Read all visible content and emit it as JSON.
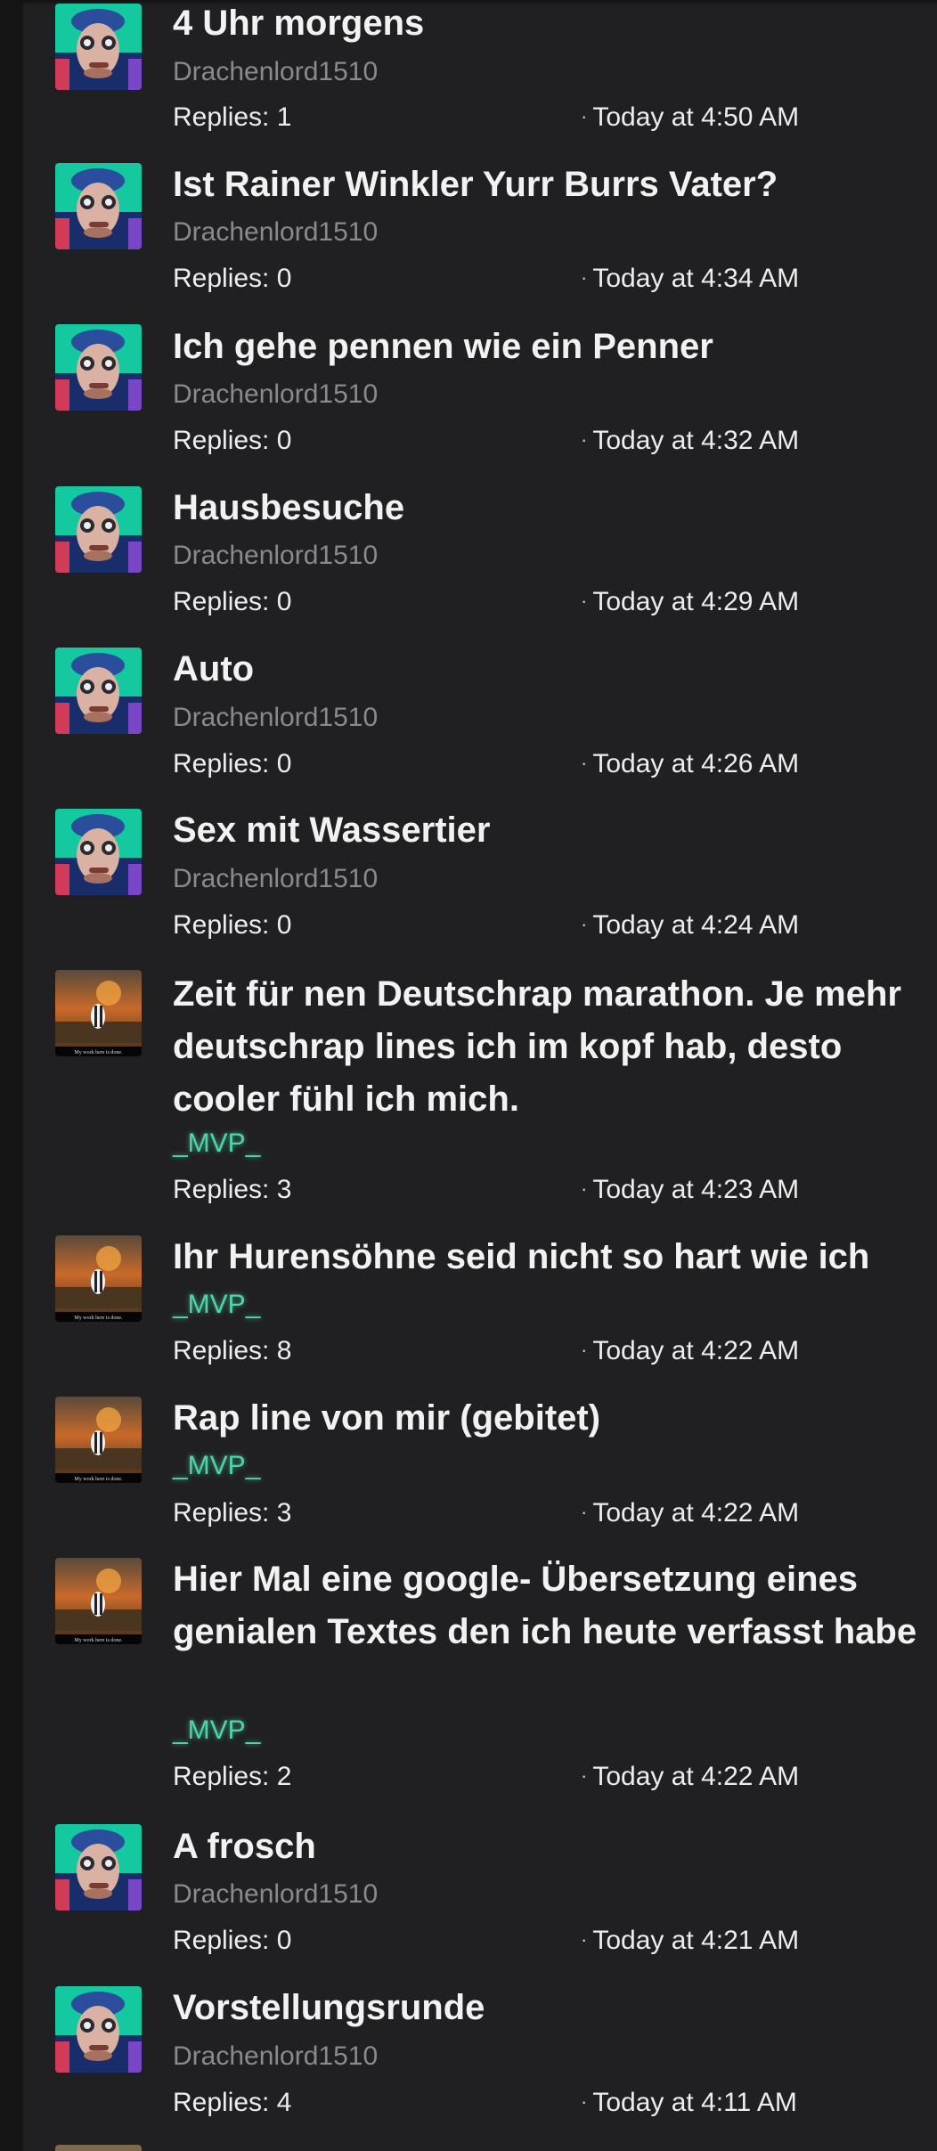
{
  "threads": [
    {
      "title": "4 Uhr morgens",
      "author": "Drachenlord1510",
      "replies": "Replies: 1",
      "date": "Today at 4:50 AM",
      "avatar": "drachenlord-avatar"
    },
    {
      "title": "Ist Rainer Winkler Yurr Burrs Vater?",
      "author": "Drachenlord1510",
      "replies": "Replies: 0",
      "date": "Today at 4:34 AM",
      "avatar": "drachenlord-avatar"
    },
    {
      "title": "Ich gehe pennen wie ein Penner",
      "author": "Drachenlord1510",
      "replies": "Replies: 0",
      "date": "Today at 4:32 AM",
      "avatar": "drachenlord-avatar"
    },
    {
      "title": "Hausbesuche",
      "author": "Drachenlord1510",
      "replies": "Replies: 0",
      "date": "Today at 4:29 AM",
      "avatar": "drachenlord-avatar"
    },
    {
      "title": "Auto",
      "author": "Drachenlord1510",
      "replies": "Replies: 0",
      "date": "Today at 4:26 AM",
      "avatar": "drachenlord-avatar"
    },
    {
      "title": "Sex mit Wassertier",
      "author": "Drachenlord1510",
      "replies": "Replies: 0",
      "date": "Today at 4:24 AM",
      "avatar": "drachenlord-avatar"
    },
    {
      "title": "Zeit für nen Deutschrap marathon. Je mehr deutschrap lines ich im kopf hab, desto cooler fühl ich mich.",
      "author": "_MVP_",
      "replies": "Replies: 3",
      "date": "Today at 4:23 AM",
      "avatar": "mvp-avatar"
    },
    {
      "title": "Ihr Hurensöhne seid nicht so hart wie ich",
      "author": "_MVP_",
      "replies": "Replies: 8",
      "date": "Today at 4:22 AM",
      "avatar": "mvp-avatar"
    },
    {
      "title": "Rap line von mir (gebitet)",
      "author": "_MVP_",
      "replies": "Replies: 3",
      "date": "Today at 4:22 AM",
      "avatar": "mvp-avatar"
    },
    {
      "title": "Hier Mal eine google- Übersetzung eines genialen Textes den ich heute verfasst habe",
      "author": "_MVP_",
      "replies": "Replies: 2",
      "date": "Today at 4:22 AM",
      "avatar": "mvp-avatar"
    },
    {
      "title": "A frosch",
      "author": "Drachenlord1510",
      "replies": "Replies: 0",
      "date": "Today at 4:21 AM",
      "avatar": "drachenlord-avatar"
    },
    {
      "title": "Vorstellungsrunde",
      "author": "Drachenlord1510",
      "replies": "Replies: 4",
      "date": "Today at 4:11 AM",
      "avatar": "drachenlord-avatar"
    }
  ],
  "mvp_avatar_caption": "My work here is done.",
  "colors": {
    "background": "#202022",
    "title": "#f2f2f2",
    "author": "#8a8a8e",
    "mvp_author": "#4fd3a8"
  }
}
